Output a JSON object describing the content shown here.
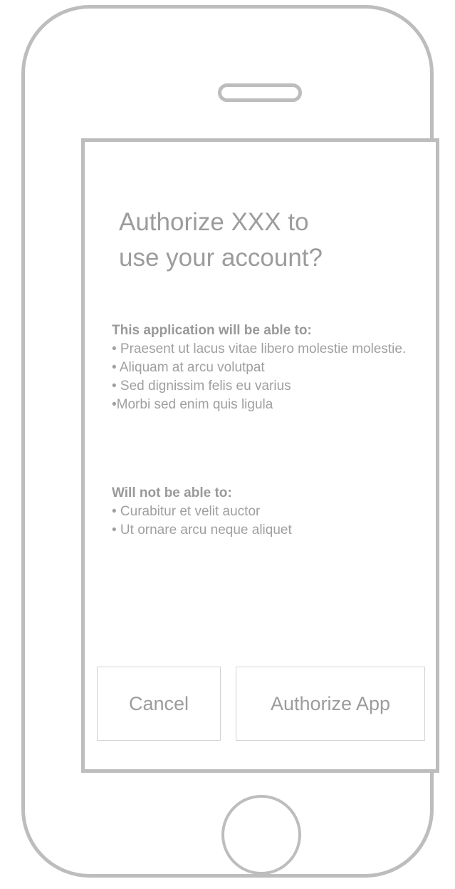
{
  "dialog": {
    "title_line1": "Authorize XXX to",
    "title_line2": "use your account?"
  },
  "permissions": {
    "can_heading": "This application will be able to:",
    "can_items": [
      "• Praesent ut lacus vitae libero molestie molestie.",
      "• Aliquam at arcu volutpat",
      "• Sed dignissim felis eu varius",
      "•Morbi sed enim quis ligula"
    ],
    "cannot_heading": "Will not be able to:",
    "cannot_items": [
      "• Curabitur et velit auctor",
      "• Ut ornare arcu neque aliquet"
    ]
  },
  "buttons": {
    "cancel_label": "Cancel",
    "authorize_label": "Authorize App"
  },
  "colors": {
    "outline": "#bdbdbd",
    "text": "#9c9c9c",
    "button_border": "#d2d2d2"
  }
}
